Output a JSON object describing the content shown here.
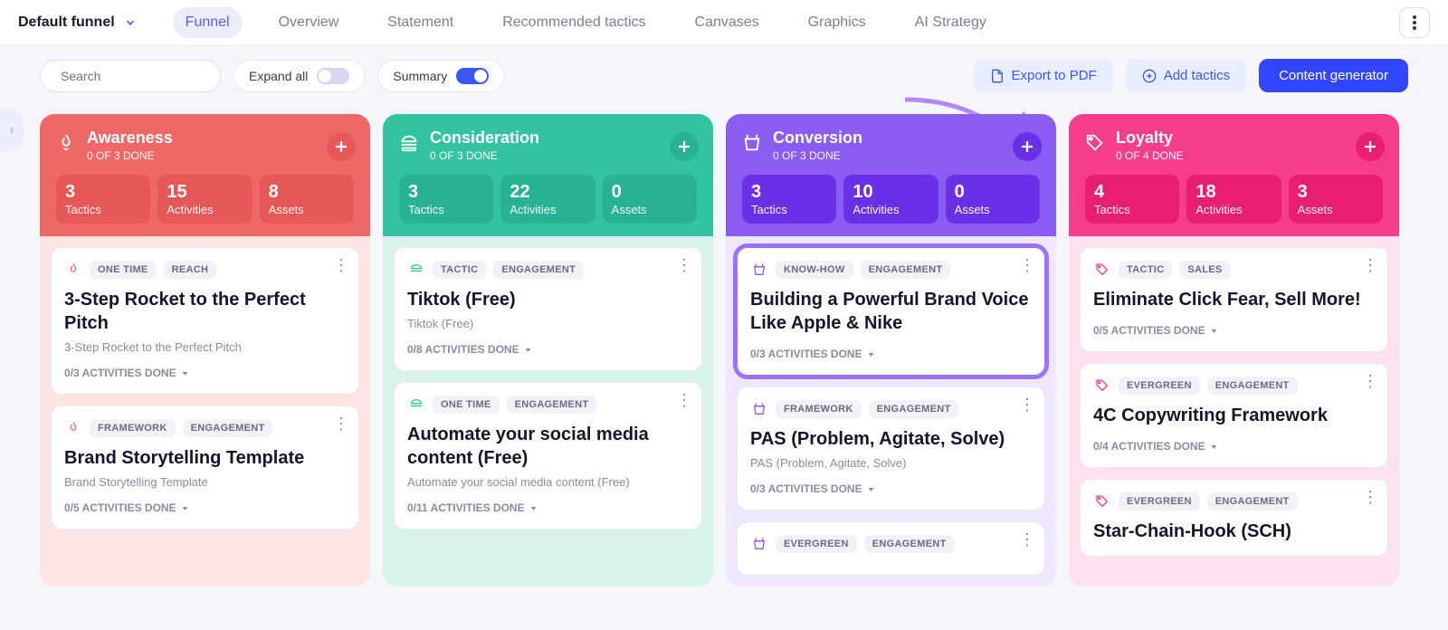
{
  "header": {
    "funnel_label": "Default funnel",
    "tabs": [
      "Funnel",
      "Overview",
      "Statement",
      "Recommended tactics",
      "Canvases",
      "Graphics",
      "AI Strategy"
    ],
    "active_tab": 0
  },
  "toolbar": {
    "search_placeholder": "Search",
    "expand_label": "Expand all",
    "summary_label": "Summary",
    "export_label": "Export to PDF",
    "add_label": "Add tactics",
    "generator_label": "Content generator"
  },
  "columns": [
    {
      "key": "aw",
      "title": "Awareness",
      "sub": "0 OF 3 DONE",
      "stats": [
        {
          "n": "3",
          "lbl": "Tactics"
        },
        {
          "n": "15",
          "lbl": "Activities"
        },
        {
          "n": "8",
          "lbl": "Assets"
        }
      ],
      "cards": [
        {
          "tags": [
            "ONE TIME",
            "REACH"
          ],
          "title": "3-Step Rocket to the Perfect Pitch",
          "desc": "3-Step Rocket to the Perfect Pitch",
          "act": "0/3 ACTIVITIES DONE"
        },
        {
          "tags": [
            "FRAMEWORK",
            "ENGAGEMENT"
          ],
          "title": "Brand Storytelling Template",
          "desc": "Brand Storytelling Template",
          "act": "0/5 ACTIVITIES DONE"
        }
      ]
    },
    {
      "key": "co",
      "title": "Consideration",
      "sub": "0 OF 3 DONE",
      "stats": [
        {
          "n": "3",
          "lbl": "Tactics"
        },
        {
          "n": "22",
          "lbl": "Activities"
        },
        {
          "n": "0",
          "lbl": "Assets"
        }
      ],
      "cards": [
        {
          "tags": [
            "TACTIC",
            "ENGAGEMENT"
          ],
          "title": "Tiktok (Free)",
          "desc": "Tiktok (Free)",
          "act": "0/8 ACTIVITIES DONE"
        },
        {
          "tags": [
            "ONE TIME",
            "ENGAGEMENT"
          ],
          "title": "Automate your social media content (Free)",
          "desc": "Automate your social media content (Free)",
          "act": "0/11 ACTIVITIES DONE"
        }
      ]
    },
    {
      "key": "cv",
      "title": "Conversion",
      "sub": "0 OF 3 DONE",
      "stats": [
        {
          "n": "3",
          "lbl": "Tactics"
        },
        {
          "n": "10",
          "lbl": "Activities"
        },
        {
          "n": "0",
          "lbl": "Assets"
        }
      ],
      "cards": [
        {
          "hl": true,
          "tags": [
            "KNOW-HOW",
            "ENGAGEMENT"
          ],
          "title": "Building a Powerful Brand Voice Like Apple & Nike",
          "desc": "",
          "act": "0/3 ACTIVITIES DONE"
        },
        {
          "tags": [
            "FRAMEWORK",
            "ENGAGEMENT"
          ],
          "title": "PAS (Problem, Agitate, Solve)",
          "desc": "PAS (Problem, Agitate, Solve)",
          "act": "0/3 ACTIVITIES DONE"
        },
        {
          "tags": [
            "EVERGREEN",
            "ENGAGEMENT"
          ],
          "title": "",
          "desc": "",
          "act": ""
        }
      ]
    },
    {
      "key": "lo",
      "title": "Loyalty",
      "sub": "0 OF 4 DONE",
      "stats": [
        {
          "n": "4",
          "lbl": "Tactics"
        },
        {
          "n": "18",
          "lbl": "Activities"
        },
        {
          "n": "3",
          "lbl": "Assets"
        }
      ],
      "cards": [
        {
          "tags": [
            "TACTIC",
            "SALES"
          ],
          "title": "Eliminate Click Fear, Sell More!",
          "desc": "",
          "act": "0/5 ACTIVITIES DONE"
        },
        {
          "tags": [
            "EVERGREEN",
            "ENGAGEMENT"
          ],
          "title": "4C Copywriting Framework",
          "desc": "",
          "act": "0/4 ACTIVITIES DONE"
        },
        {
          "tags": [
            "EVERGREEN",
            "ENGAGEMENT"
          ],
          "title": "Star-Chain-Hook (SCH)",
          "desc": "",
          "act": ""
        }
      ]
    }
  ],
  "icons": {
    "aw": "🔥",
    "co": "🍔",
    "cv": "🛍️",
    "lo": "🏷️"
  }
}
